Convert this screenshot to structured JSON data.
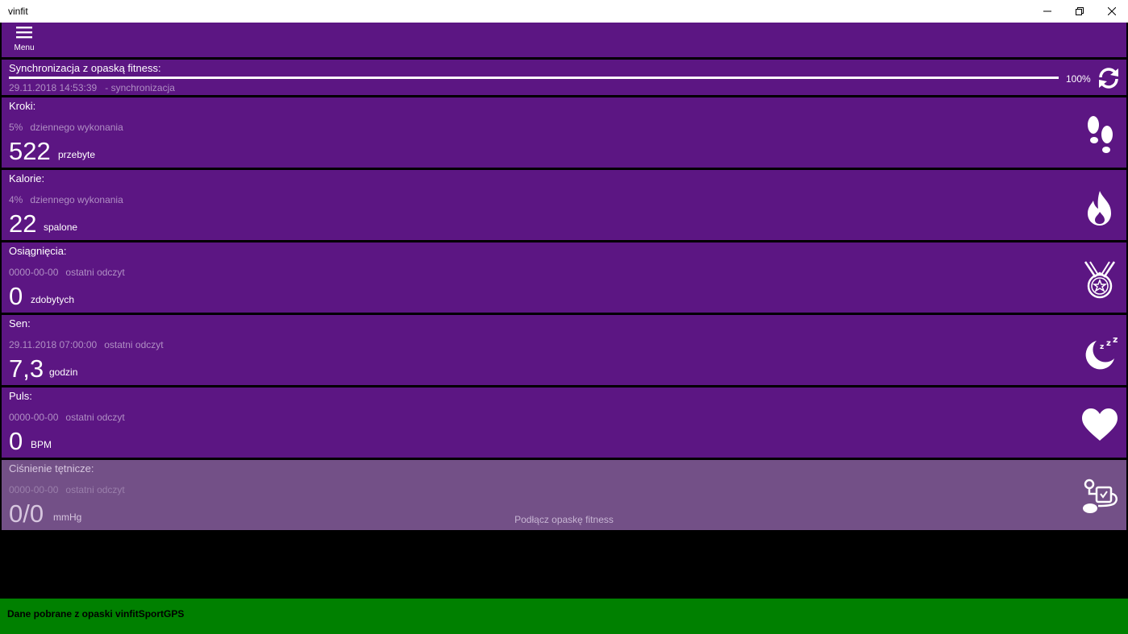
{
  "window": {
    "title": "vinfit"
  },
  "menu": {
    "label": "Menu"
  },
  "sync": {
    "title": "Synchronizacja z opaską fitness:",
    "timestamp": "29.11.2018 14:53:39",
    "status": "- synchronizacja",
    "percent_label": "100%",
    "progress": 1.0
  },
  "metrics": [
    {
      "label": "Kroki:",
      "sub1": "5%",
      "sub2": "dziennego wykonania",
      "value": "522",
      "unit": "przebyte",
      "icon": "footsteps-icon"
    },
    {
      "label": "Kalorie:",
      "sub1": "4%",
      "sub2": "dziennego wykonania",
      "value": "22",
      "unit": "spalone",
      "icon": "flame-icon"
    },
    {
      "label": "Osiągnięcia:",
      "sub1": "0000-00-00",
      "sub2": "ostatni odczyt",
      "value": "0",
      "unit": "zdobytych",
      "icon": "medal-icon"
    },
    {
      "label": "Sen:",
      "sub1": "29.11.2018 07:00:00",
      "sub2": "ostatni odczyt",
      "value": "7,3",
      "unit": "godzin",
      "icon": "moon-sleep-icon"
    },
    {
      "label": "Puls:",
      "sub1": "0000-00-00",
      "sub2": "ostatni odczyt",
      "value": "0",
      "unit": "BPM",
      "icon": "heart-icon"
    },
    {
      "label": "Ciśnienie tętnicze:",
      "sub1": "0000-00-00",
      "sub2": "ostatni odczyt",
      "value": "0/0",
      "unit": "mmHg",
      "icon": "blood-pressure-icon",
      "message": "Podłącz opaskę fitness"
    }
  ],
  "statusbar": {
    "text": "Dane pobrane z opaski vinfitSportGPS"
  },
  "colors": {
    "panel": "#5c1683",
    "panel_disabled": "#735087",
    "status": "#008000"
  }
}
